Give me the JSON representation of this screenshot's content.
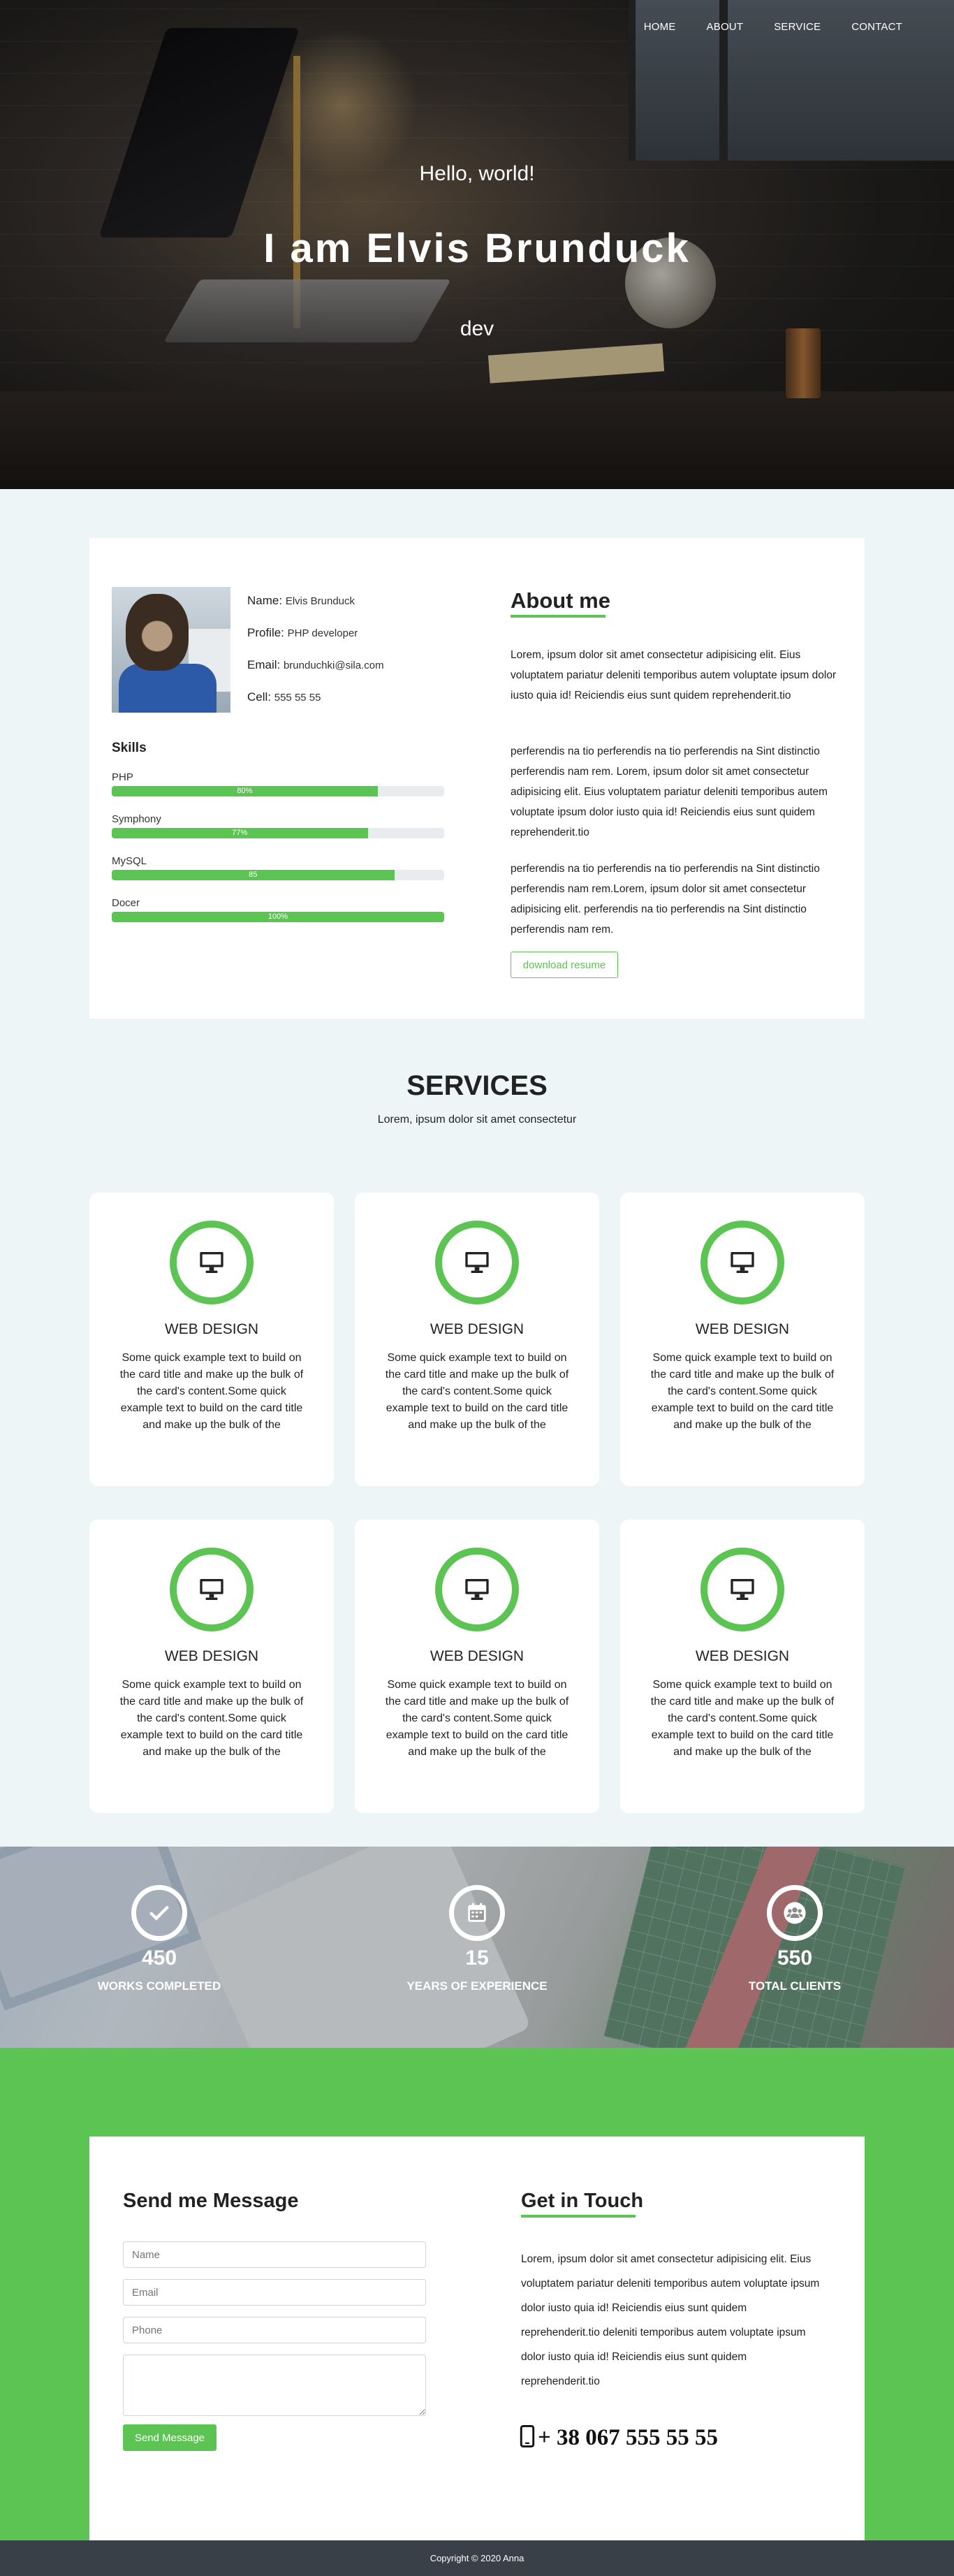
{
  "nav": {
    "items": [
      "HOME",
      "ABOUT",
      "SERVICE",
      "CONTACT"
    ]
  },
  "hero": {
    "greeting": "Hello, world!",
    "name": "I am Elvis Brunduck",
    "role": "dev"
  },
  "about": {
    "profile": [
      {
        "label": "Name:",
        "value": "Elvis Brunduck"
      },
      {
        "label": "Profile:",
        "value": "PHP developer"
      },
      {
        "label": "Email:",
        "value": "brunduchki@sila.com"
      },
      {
        "label": "Cell:",
        "value": "555 55 55"
      }
    ],
    "skills_title": "Skills",
    "skills": [
      {
        "name": "PHP",
        "percent": 80,
        "label": "80%"
      },
      {
        "name": "Symphony",
        "percent": 77,
        "label": "77%"
      },
      {
        "name": "MySQL",
        "percent": 85,
        "label": "85"
      },
      {
        "name": "Docer",
        "percent": 100,
        "label": "100%"
      }
    ],
    "title": "About me",
    "paragraphs": [
      "Lorem, ipsum dolor sit amet consectetur adipisicing elit. Eius voluptatem pariatur deleniti temporibus autem voluptate ipsum dolor iusto quia id! Reiciendis eius sunt quidem reprehenderit.tio",
      "perferendis na tio perferendis na tio perferendis na Sint distinctio perferendis nam rem. Lorem, ipsum dolor sit amet consectetur adipisicing elit. Eius voluptatem pariatur deleniti temporibus autem voluptate ipsum dolor iusto quia id! Reiciendis eius sunt quidem reprehenderit.tio",
      "perferendis na tio perferendis na tio perferendis na Sint distinctio perferendis nam rem.Lorem, ipsum dolor sit amet consectetur adipisicing elit. perferendis na tio perferendis na Sint distinctio perferendis nam rem."
    ],
    "resume_button": "download resume"
  },
  "services": {
    "title": "SERVICES",
    "subtitle": "Lorem, ipsum dolor sit amet consectetur",
    "icon": "monitor-icon",
    "cards": [
      {
        "title": "WEB DESIGN",
        "text": "Some quick example text to build on the card title and make up the bulk of the card's content.Some quick example text to build on the card title and make up the bulk of the"
      },
      {
        "title": "WEB DESIGN",
        "text": "Some quick example text to build on the card title and make up the bulk of the card's content.Some quick example text to build on the card title and make up the bulk of the"
      },
      {
        "title": "WEB DESIGN",
        "text": "Some quick example text to build on the card title and make up the bulk of the card's content.Some quick example text to build on the card title and make up the bulk of the"
      },
      {
        "title": "WEB DESIGN",
        "text": "Some quick example text to build on the card title and make up the bulk of the card's content.Some quick example text to build on the card title and make up the bulk of the"
      },
      {
        "title": "WEB DESIGN",
        "text": "Some quick example text to build on the card title and make up the bulk of the card's content.Some quick example text to build on the card title and make up the bulk of the"
      },
      {
        "title": "WEB DESIGN",
        "text": "Some quick example text to build on the card title and make up the bulk of the card's content.Some quick example text to build on the card title and make up the bulk of the"
      }
    ]
  },
  "stats": [
    {
      "icon": "check-icon",
      "number": "450",
      "label": "WORKS COMPLETED"
    },
    {
      "icon": "calendar-icon",
      "number": "15",
      "label": "YEARS OF EXPERIENCE"
    },
    {
      "icon": "users-icon",
      "number": "550",
      "label": "TOTAL CLIENTS"
    }
  ],
  "contact": {
    "form_title": "Send me Message",
    "name_placeholder": "Name",
    "email_placeholder": "Email",
    "phone_placeholder": "Phone",
    "message_placeholder": "",
    "send_button": "Send Message",
    "touch_title": "Get in Touch",
    "touch_text": "Lorem, ipsum dolor sit amet consectetur adipisicing elit. Eius voluptatem pariatur deleniti temporibus autem voluptate ipsum dolor iusto quia id! Reiciendis eius sunt quidem reprehenderit.tio deleniti temporibus autem voluptate ipsum dolor iusto quia id! Reiciendis eius sunt quidem reprehenderit.tio",
    "phone": "+ 38 067 555 55 55"
  },
  "footer": {
    "text": "Copyright © 2020 Anna"
  },
  "colors": {
    "accent": "#5cc452",
    "footer": "#3a4047",
    "page_bg": "#eef5f6"
  }
}
